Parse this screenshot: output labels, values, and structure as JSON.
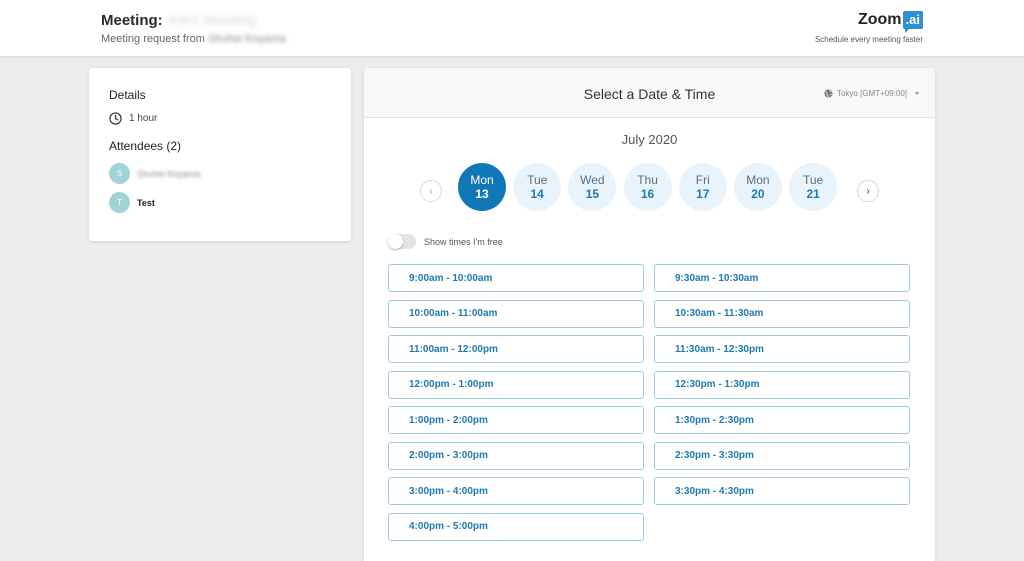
{
  "header": {
    "meeting_label": "Meeting:",
    "meeting_name": "Intro Meeting",
    "request_prefix": "Meeting request from",
    "requester": "Shuhei Koyama"
  },
  "brand": {
    "name": "Zoom",
    "badge": ".ai",
    "tagline": "Schedule every meeting faster"
  },
  "details": {
    "heading": "Details",
    "duration": "1 hour",
    "attendees_heading": "Attendees (2)",
    "attendees": [
      {
        "initial": "S",
        "name": "Shuhei Koyama",
        "blurred": true
      },
      {
        "initial": "T",
        "name": "Test",
        "blurred": false
      }
    ]
  },
  "scheduler": {
    "title": "Select a Date & Time",
    "timezone": "Tokyo [GMT+09:00]",
    "month": "July 2020",
    "prev_label": "‹",
    "next_label": "›",
    "days": [
      {
        "dow": "Mon",
        "num": "13",
        "selected": true
      },
      {
        "dow": "Tue",
        "num": "14",
        "selected": false
      },
      {
        "dow": "Wed",
        "num": "15",
        "selected": false
      },
      {
        "dow": "Thu",
        "num": "16",
        "selected": false
      },
      {
        "dow": "Fri",
        "num": "17",
        "selected": false
      },
      {
        "dow": "Mon",
        "num": "20",
        "selected": false
      },
      {
        "dow": "Tue",
        "num": "21",
        "selected": false
      }
    ],
    "toggle_label": "Show times I'm free",
    "toggle_on": false,
    "slots_left": [
      "9:00am - 10:00am",
      "10:00am - 11:00am",
      "11:00am - 12:00pm",
      "12:00pm - 1:00pm",
      "1:00pm - 2:00pm",
      "2:00pm - 3:00pm",
      "3:00pm - 4:00pm",
      "4:00pm - 5:00pm"
    ],
    "slots_right": [
      "9:30am - 10:30am",
      "10:30am - 11:30am",
      "11:30am - 12:30pm",
      "12:30pm - 1:30pm",
      "1:30pm - 2:30pm",
      "2:30pm - 3:30pm",
      "3:30pm - 4:30pm"
    ]
  },
  "colors": {
    "accent": "#1178b8",
    "day_bg": "#e8f3fb",
    "slot_border": "#9ccbe8",
    "avatar": "#9fd4d6"
  }
}
